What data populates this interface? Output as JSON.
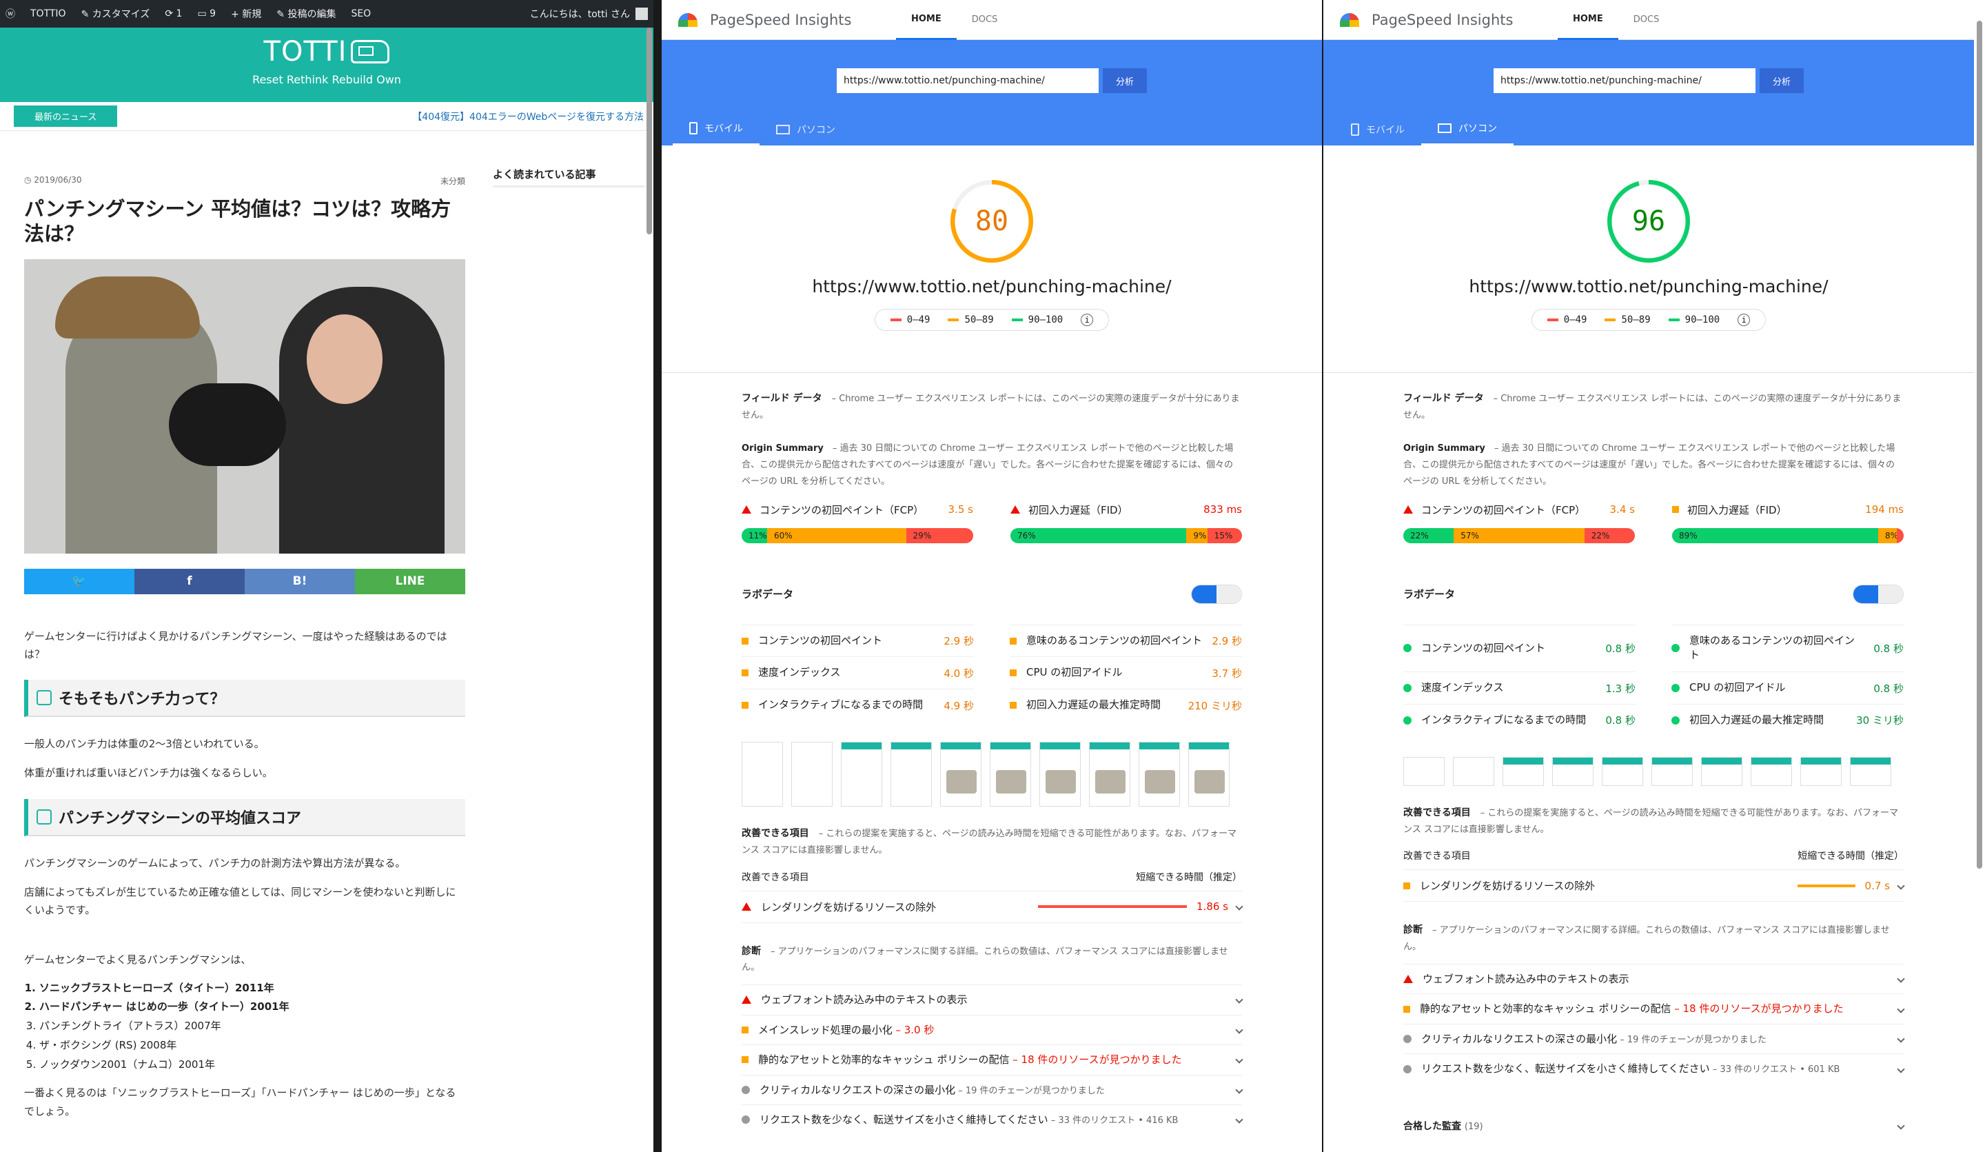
{
  "blog": {
    "adminbar": {
      "site": "TOTTIO",
      "customize": "カスタマイズ",
      "updates": "1",
      "comments": "9",
      "new": "新規",
      "edit": "投稿の編集",
      "seo": "SEO",
      "greeting": "こんにちは、totti さん"
    },
    "site_title": "TOTTI",
    "tagline": "Reset Rethink Rebuild Own",
    "news_label": "最新のニュース",
    "news_link": "【404復元】404エラーのWebページを復元する方法",
    "date": "2019/06/30",
    "category": "未分類",
    "title": "パンチングマシーン 平均値は？コツは？攻略方法は？",
    "share": [
      " ",
      "f",
      "B!",
      "LINE"
    ],
    "intro": "ゲームセンターに行けばよく見かけるパンチングマシーン、一度はやった経験はあるのではは？",
    "h2a": "そもそもパンチ力って？",
    "p1": "一般人のパンチ力は体重の2〜3倍といわれている。",
    "p2": "体重が重ければ重いほどパンチ力は強くなるらしい。",
    "h2b": "パンチングマシーンの平均値スコア",
    "p3": "パンチングマシーンのゲームによって、パンチ力の計測方法や算出方法が異なる。",
    "p4": "店舗によってもズレが生じているため正確な値としては、同じマシーンを使わないと判断しにくいようです。",
    "p5": "ゲームセンターでよく見るパンチングマシンは、",
    "list": [
      "ソニックブラストヒーローズ（タイトー）2011年",
      "ハードパンチャー はじめの一歩（タイトー）2001年",
      "パンチングトライ（アトラス）2007年",
      "ザ・ボクシング (RS) 2008年",
      "ノックダウン2001（ナムコ）2001年"
    ],
    "p6": "一番よく見るのは「ソニックブラストヒーローズ」「ハードパンチャー はじめの一歩」となるでしょう。",
    "sidebar_title": "よく読まれている記事"
  },
  "psi_common": {
    "app": "PageSpeed Insights",
    "home": "HOME",
    "docs": "DOCS",
    "url_value": "https://www.tottio.net/punching-machine/",
    "analyze": "分析",
    "mobile": "モバイル",
    "desktop": "パソコン",
    "page_url": "https://www.tottio.net/punching-machine/",
    "legend": [
      "0–49",
      "50–89",
      "90–100"
    ],
    "field_title": "フィールド データ",
    "field_desc": "– Chrome ユーザー エクスペリエンス レポートには、このページの",
    "field_link": "実際の速度データが十分にありません。",
    "origin_title": "Origin Summary",
    "origin_desc": "– 過去 30 日間についての Chrome ユーザー エクスペリエンス レポートで他のページと比較した場合、この提供元から配信されたすべてのページは速度が「遅い」でした。各ページに合わせた提案を確認するには、個々のページの URL を分析してください。",
    "fcp_label": "コンテンツの初回ペイント（FCP）",
    "fid_label": "初回入力遅延（FID）",
    "lab_title": "ラボデータ",
    "lab_labels": [
      "コンテンツの初回ペイント",
      "意味のあるコンテンツの初回ペイント",
      "速度インデックス",
      "CPU の初回アイドル",
      "インタラクティブになるまでの時間",
      "初回入力遅延の最大推定時間"
    ],
    "opp_title": "改善できる項目",
    "opp_desc": "– これらの提案を実施すると、ページの読み込み時間を短縮できる可能性があります。なお、パフォーマンス スコアには直接影響しません。",
    "opp_col1": "改善できる項目",
    "opp_col2": "短縮できる時間（推定）",
    "opp_item": "レンダリングを妨げるリソースの除外",
    "diag_title": "診断",
    "diag_desc": "– アプリケーションのパフォーマンスに関する詳細。これらの数値は、パフォーマンス スコアには直接影響しません。",
    "passed": "合格した監査",
    "passed_count": "(19)"
  },
  "psi_mobile": {
    "score": "80",
    "fcp": "3.5 s",
    "fid": "833 ms",
    "fcp_dist": [
      "11%",
      "60%",
      "29%"
    ],
    "fid_dist": [
      "76%",
      "9%",
      "15%"
    ],
    "lab_values": [
      "2.9 秒",
      "2.9 秒",
      "4.0 秒",
      "3.7 秒",
      "4.9 秒",
      "210 ミリ秒"
    ],
    "opp_value": "1.86 s",
    "diags": [
      {
        "t": "ウェブフォント読み込み中のテキストの表示",
        "s": ""
      },
      {
        "t": "メインスレッド処理の最小化",
        "s": " – 3.0 秒"
      },
      {
        "t": "静的なアセットと効率的なキャッシュ ポリシーの配信",
        "s": " – 18 件のリソースが見つかりました"
      },
      {
        "t": "クリティカルなリクエストの深さの最小化",
        "s": " – 19 件のチェーンが見つかりました"
      },
      {
        "t": "リクエスト数を少なく、転送サイズを小さく維持してください",
        "s": " – 33 件のリクエスト • 416 KB"
      }
    ]
  },
  "psi_desktop": {
    "score": "96",
    "fcp": "3.4 s",
    "fid": "194 ms",
    "fcp_dist": [
      "22%",
      "57%",
      "22%"
    ],
    "fid_dist": [
      "89%",
      "8%",
      "3%"
    ],
    "lab_values": [
      "0.8 秒",
      "0.8 秒",
      "1.3 秒",
      "0.8 秒",
      "0.8 秒",
      "30 ミリ秒"
    ],
    "opp_value": "0.7 s",
    "diags": [
      {
        "t": "ウェブフォント読み込み中のテキストの表示",
        "s": ""
      },
      {
        "t": "静的なアセットと効率的なキャッシュ ポリシーの配信",
        "s": " – 18 件のリソースが見つかりました"
      },
      {
        "t": "クリティカルなリクエストの深さの最小化",
        "s": " – 19 件のチェーンが見つかりました"
      },
      {
        "t": "リクエスト数を少なく、転送サイズを小さく維持してください",
        "s": " – 33 件のリクエスト • 601 KB"
      }
    ]
  },
  "colors": {
    "teal": "#1bb5a3",
    "psi_blue": "#4285f4",
    "fail": "#eb0f00",
    "average": "#ffa400",
    "pass": "#0cce6b"
  }
}
